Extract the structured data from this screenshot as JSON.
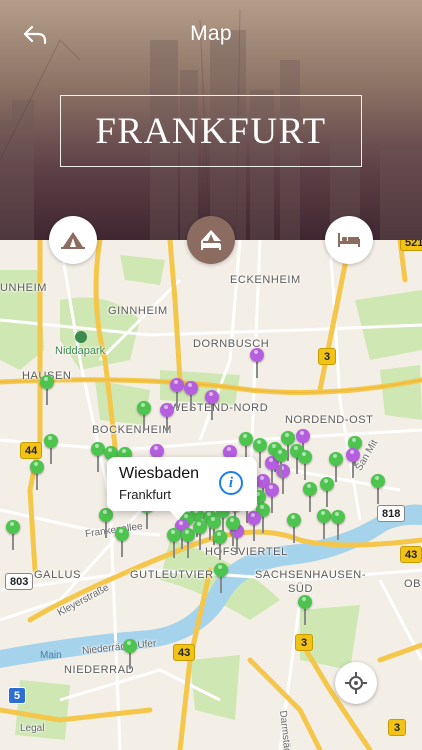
{
  "nav": {
    "title": "Map",
    "back_icon": "back-arrow-icon"
  },
  "header": {
    "city": "FRANKFURT"
  },
  "tabs": [
    {
      "name": "attractions",
      "icon": "tent-icon",
      "active": false
    },
    {
      "name": "hotels",
      "icon": "hotel-tent-icon",
      "active": true
    },
    {
      "name": "lodging",
      "icon": "bed-icon",
      "active": false
    }
  ],
  "map": {
    "districts": {
      "unheim": "UNHEIM",
      "eckenheim": "ECKENHEIM",
      "ginnheim": "GINNHEIM",
      "dornbusch": "DORNBUSCH",
      "hausen": "HAUSEN",
      "westend": "WESTEND-NORD",
      "nordend": "NORDEND-OST",
      "bockenheim": "BOCKENHEIM",
      "gallus": "GALLUS",
      "gutleut": "GUTLEUTVIER",
      "bahnhof": "HOFSVIERTEL",
      "sachsenhausen": "SACHSENHAUSEN-",
      "sud": "SÜD",
      "ob": "OB",
      "niederrad": "NIEDERRAD"
    },
    "park": "Niddapark",
    "streets": {
      "frankenallee": "Frankenallee",
      "kleyer": "Kleyerstraße",
      "niederrader": "Niederräder Ufer",
      "darmstaedter": "Darmstädter L",
      "sanmit": "San Mit"
    },
    "river": "Main",
    "legal": "Legal",
    "shields": {
      "s521": "521",
      "s3a": "3",
      "s44": "44",
      "s818": "818",
      "s43a": "43",
      "s803": "803",
      "s3b": "3",
      "s43b": "43",
      "s5": "5",
      "s3c": "3"
    },
    "pins": {
      "green": "#4cc44e",
      "purple": "#b55fe0"
    },
    "callout": {
      "title": "Wiesbaden",
      "subtitle": "Frankfurt",
      "info_icon": "info-icon"
    },
    "locate_icon": "crosshair-icon",
    "colors": {
      "land": "#f4efe6",
      "park": "#cfe7b3",
      "water": "#a6d3ec",
      "highway": "#f4c64a",
      "road": "#ffffff"
    }
  }
}
